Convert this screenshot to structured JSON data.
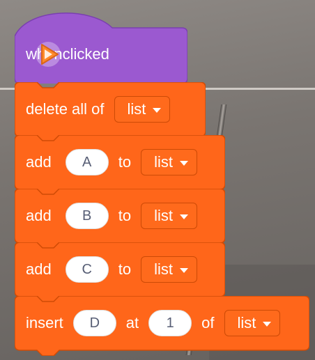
{
  "event_block": {
    "when_label": "when",
    "clicked_label": "clicked",
    "icon": "green-flag-icon"
  },
  "blocks": [
    {
      "keyword": "delete all of",
      "list": "list"
    },
    {
      "keyword": "add",
      "value": "A",
      "to": "to",
      "list": "list"
    },
    {
      "keyword": "add",
      "value": "B",
      "to": "to",
      "list": "list"
    },
    {
      "keyword": "add",
      "value": "C",
      "to": "to",
      "list": "list"
    },
    {
      "keyword": "insert",
      "value": "D",
      "at": "at",
      "index": "1",
      "of": "of",
      "list": "list"
    }
  ],
  "colors": {
    "events": "#9b59d0",
    "list": "#ff661a",
    "list_border": "#cf4b06",
    "play_icon": "#ff8a2a"
  }
}
